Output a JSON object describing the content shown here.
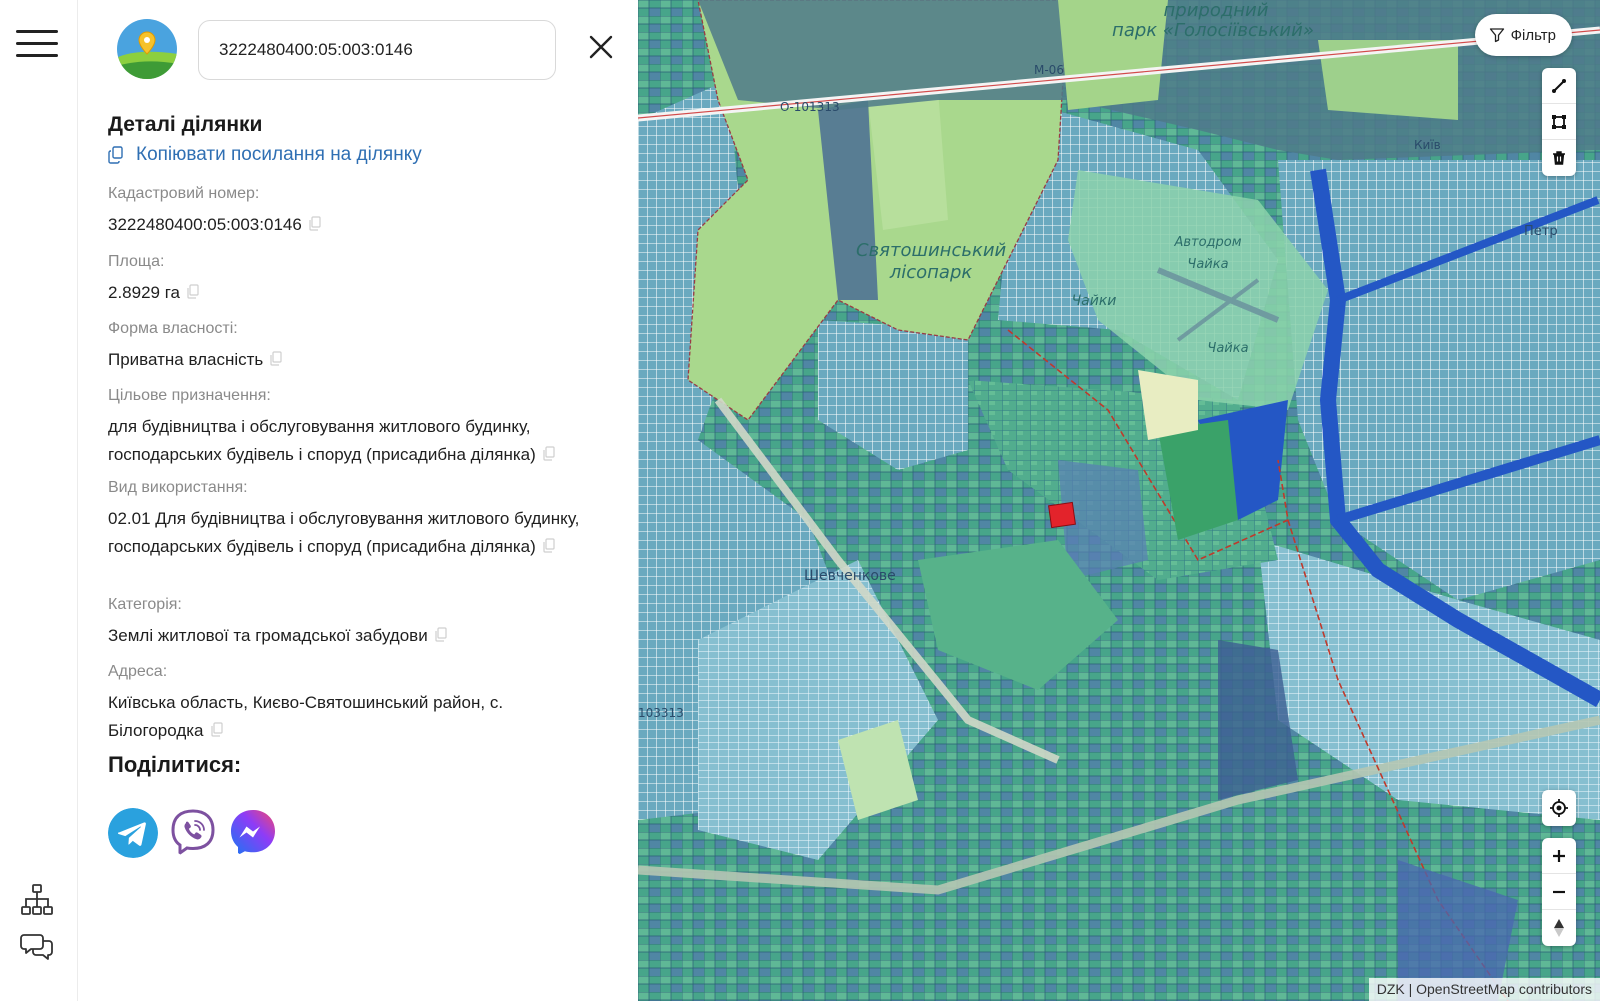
{
  "search": {
    "value": "3222480400:05:003:0146"
  },
  "details": {
    "title": "Деталі ділянки",
    "copy_link": "Копіювати посилання на ділянку",
    "fields": [
      {
        "label": "Кадастровий номер:",
        "value": "3222480400:05:003:0146"
      },
      {
        "label": "Площа:",
        "value": "2.8929 га"
      },
      {
        "label": "Форма власності:",
        "value": "Приватна власність"
      },
      {
        "label": "Цільове призначення:",
        "value": "для будівництва і обслуговування житлового будинку, господарських будівель і споруд (присадибна ділянка)"
      },
      {
        "label": "Вид використання:",
        "value": "02.01 Для будівництва і обслуговування житлового будинку, господарських будівель і споруд (присадибна ділянка)"
      },
      {
        "label": "Категорія:",
        "value": "Землі житлової та громадської забудови"
      },
      {
        "label": "Адреса:",
        "value": "Київська область, Києво-Святошинський район, с. Білогородка"
      }
    ],
    "share_title": "Поділитися:"
  },
  "share": [
    "telegram-icon",
    "viber-icon",
    "messenger-icon"
  ],
  "map": {
    "filter_label": "Фільтр",
    "labels": {
      "park_top": "парк «Голосіївський»",
      "park_top_prefix": "природний",
      "forest": "Святошинський лісопарк",
      "airfield": "Автодром Чайка",
      "chaika_village": "Чайки",
      "chaika_airport": "Чайка",
      "road_m06": "М-06",
      "road_o101313": "О-101313",
      "road_103313": "103313",
      "shevchenkove": "Шевченкове",
      "petro": "Петр",
      "kyiv_road": "Київ"
    },
    "attribution": "DZK | OpenStreetMap contributors",
    "colors": {
      "selected_parcel": "#e3232b",
      "boundary": "#c0392b",
      "road": "#2457c5"
    }
  },
  "icons": {
    "menu": "hamburger-icon",
    "structure": "sitemap-icon",
    "chat": "chat-bubbles-icon",
    "close": "close-icon",
    "copy": "copy-icon",
    "filter": "funnel-icon",
    "draw_line": "draw-line-icon",
    "draw_polygon": "draw-polygon-icon",
    "delete": "trash-icon",
    "locate": "locate-icon",
    "zoom_in": "plus-icon",
    "zoom_out": "minus-icon",
    "north": "compass-north-icon"
  }
}
